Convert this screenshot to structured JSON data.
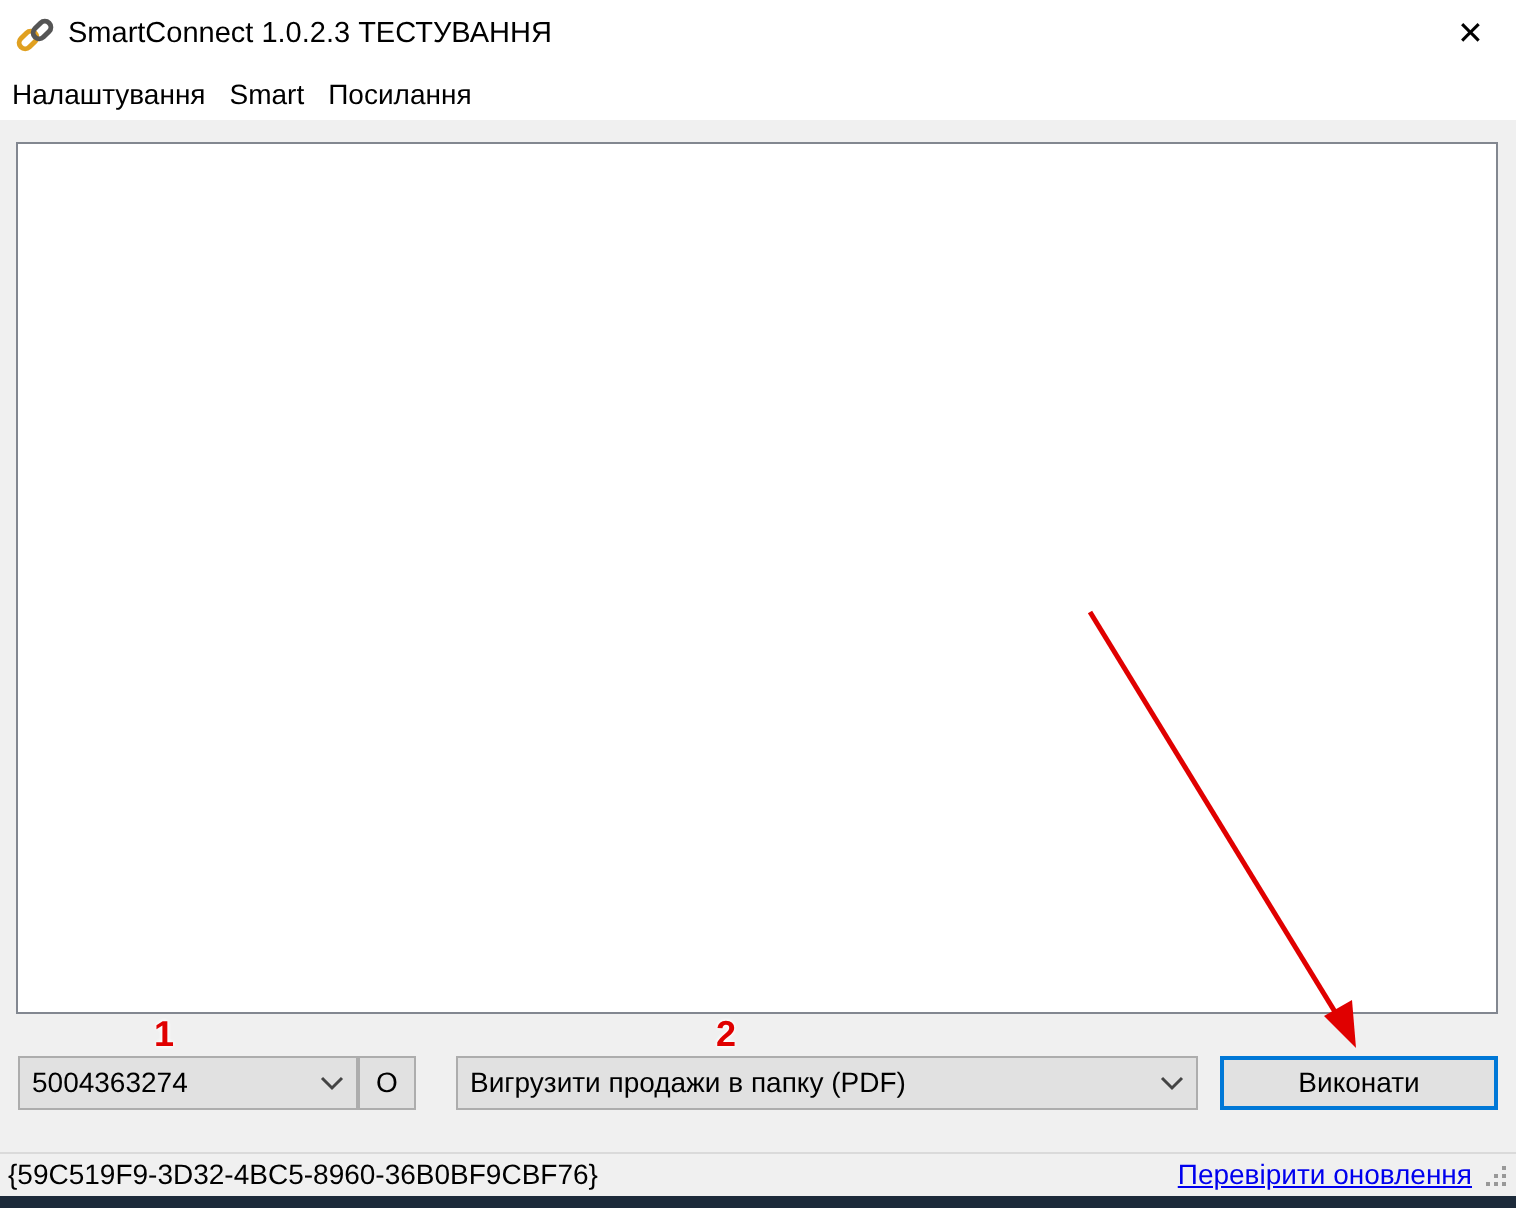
{
  "window": {
    "title": "SmartConnect 1.0.2.3 ТЕСТУВАННЯ",
    "close": "✕"
  },
  "menu": [
    "Налаштування",
    "Smart",
    "Посилання"
  ],
  "controls": {
    "account": {
      "value": "5004363274"
    },
    "account_button": "O",
    "action": {
      "value": "Вигрузити продажи в папку (PDF)"
    },
    "run_button": {
      "label": "Виконати",
      "focused": true
    }
  },
  "status_bar": {
    "id": "{59C519F9-3D32-4BC5-8960-36B0BF9CBF76}",
    "link": "Перевірити оновлення"
  },
  "annotations": [
    {
      "kind": "number",
      "text": "1"
    },
    {
      "kind": "number",
      "text": "2"
    },
    {
      "kind": "arrow"
    }
  ]
}
